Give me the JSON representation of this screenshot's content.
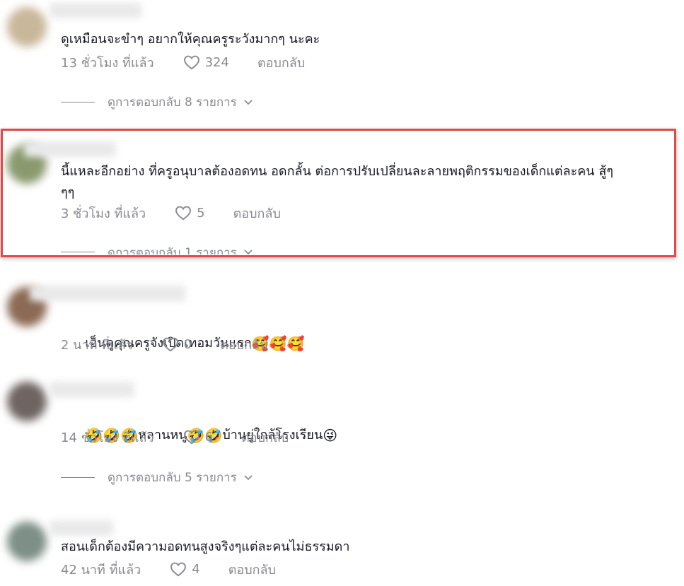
{
  "colors": {
    "text_primary": "#161823",
    "text_secondary": "#8a8b91",
    "highlight_border": "#e04a4a"
  },
  "icons": {
    "like": "heart-outline-icon",
    "expand": "chevron-down-icon"
  },
  "comments": [
    {
      "text": "ดูเหมือนจะขำๆ อยากให้คุณครูระวังมากๆ นะคะ",
      "time": "13 ชั่วโมง ที่แล้ว",
      "likes": "324",
      "reply_label": "ตอบกลับ",
      "view_replies": "ดูการตอบกลับ 8 รายการ"
    },
    {
      "text": "นี้แหละอีกอย่าง ที่ครูอนุบาลต้องอดทน อดกลั้น ต่อการปรับเปลี่ยนละลายพฤติกรรมของเด็กแต่ละคน สู้ๆ\nๆๆ",
      "time": "3 ชั่วโมง ที่แล้ว",
      "likes": "5",
      "reply_label": "ตอบกลับ",
      "view_replies": "ดูการตอบกลับ 1 รายการ"
    },
    {
      "text": "เอ็นดูคุณครูจังเปิดเทอมวันแรก",
      "emoji_suffix": "🥰🥰🥰",
      "time": "2 นาที ที่แล้ว",
      "likes": "0",
      "reply_label": "ตอบกลับ"
    },
    {
      "emoji_prefix": "🤣🤣🤣",
      "text_part1": "หลานหนู",
      "emoji_mid": "🤣🤣",
      "text_part2": "บ้านยู่ใกล้โรงเรียน",
      "emoji_suffix": "😜",
      "time": "14 ชั่วโมง ที่แล้ว",
      "likes": "6",
      "reply_label": "ตอบกลับ",
      "view_replies": "ดูการตอบกลับ 5 รายการ"
    },
    {
      "text": "สอนเด็กต้องมีความอดทนสูงจริงๆแต่ละคนไม่ธรรมดา",
      "time": "42 นาที ที่แล้ว",
      "likes": "4",
      "reply_label": "ตอบกลับ"
    }
  ]
}
